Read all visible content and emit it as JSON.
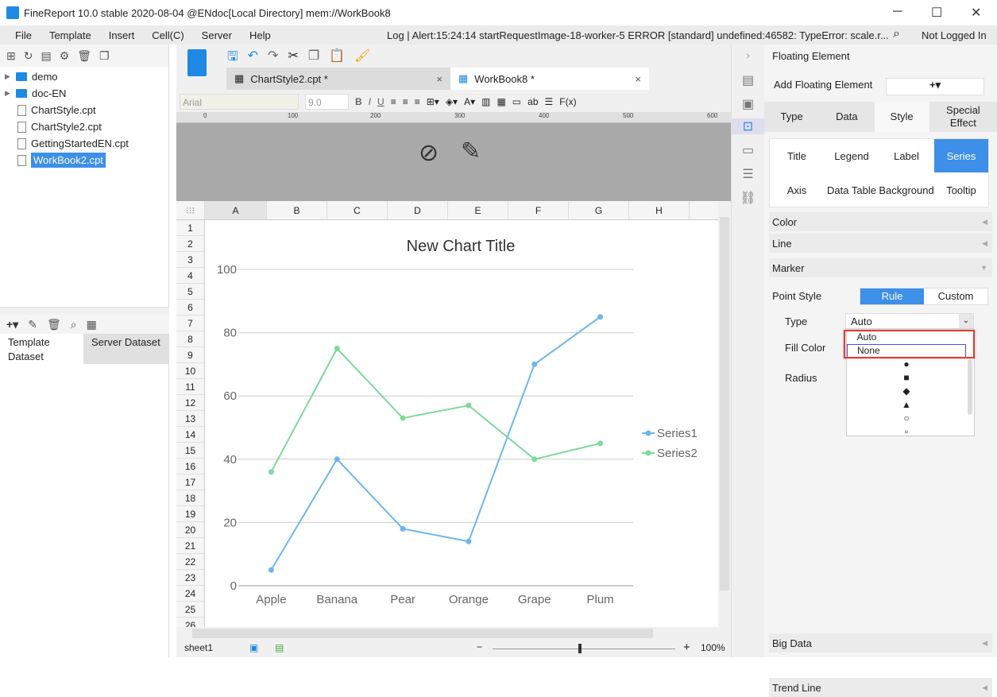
{
  "window": {
    "title": "FineReport 10.0 stable 2020-08-04 @ENdoc[Local Directory]    mem://WorkBook8",
    "minimize": "─",
    "maximize": "☐",
    "close": "✕"
  },
  "menu": {
    "items": [
      "File",
      "Template",
      "Insert",
      "Cell(C)",
      "Server",
      "Help"
    ],
    "log": "Log | Alert:15:24:14 startRequestImage-18-worker-5 ERROR [standard] undefined:46582: TypeError: scale.r...",
    "login": "Not Logged In"
  },
  "tree": {
    "folders": [
      "demo",
      "doc-EN"
    ],
    "files": [
      "ChartStyle.cpt",
      "ChartStyle2.cpt",
      "GettingStartedEN.cpt",
      "WorkBook2.cpt"
    ],
    "selected": "WorkBook2.cpt"
  },
  "dataset": {
    "tab1": "Template Dataset",
    "tab2": "Server Dataset"
  },
  "tabs": [
    {
      "label": "ChartStyle2.cpt *"
    },
    {
      "label": "WorkBook8 *"
    }
  ],
  "format": {
    "font": "Arial",
    "size": "9.0",
    "bold": "B",
    "italic": "I",
    "underline": "U",
    "ab": "ab",
    "fx": "F(x)"
  },
  "ruler": [
    "0",
    "100",
    "200",
    "300",
    "400",
    "500",
    "600"
  ],
  "columns": [
    "A",
    "B",
    "C",
    "D",
    "E",
    "F",
    "G",
    "H"
  ],
  "rows": [
    "1",
    "2",
    "3",
    "4",
    "5",
    "6",
    "7",
    "8",
    "9",
    "10",
    "11",
    "12",
    "13",
    "14",
    "15",
    "16",
    "17",
    "18",
    "19",
    "20",
    "21",
    "22",
    "23",
    "24",
    "25",
    "26"
  ],
  "chart_data": {
    "type": "line",
    "title": "New Chart Title",
    "categories": [
      "Apple",
      "Banana",
      "Pear",
      "Orange",
      "Grape",
      "Plum"
    ],
    "ylim": [
      0,
      100
    ],
    "yticks": [
      "0",
      "20",
      "40",
      "60",
      "80",
      "100"
    ],
    "grid": true,
    "legend": "right",
    "series": [
      {
        "name": "Series1",
        "color": "#6cb6f0",
        "values": [
          5,
          40,
          18,
          14,
          70,
          85
        ]
      },
      {
        "name": "Series2",
        "color": "#7ed99a",
        "values": [
          36,
          75,
          53,
          57,
          40,
          45
        ]
      }
    ]
  },
  "bottom": {
    "sheet": "sheet1",
    "zoom": "100%",
    "minus": "−",
    "plus": "+"
  },
  "panel": {
    "title": "Floating Element",
    "add_label": "Add Floating Element",
    "add_btn": "+▾",
    "tabs": [
      "Type",
      "Data",
      "Style",
      "Special Effect"
    ],
    "style_tabs": [
      "Title",
      "Legend",
      "Label",
      "Series",
      "Axis",
      "Data Table",
      "Background",
      "Tooltip"
    ],
    "sections": {
      "color": "Color",
      "line": "Line",
      "marker": "Marker",
      "big_data": "Big Data",
      "trend_line": "Trend Line"
    },
    "point_style": "Point Style",
    "rule": "Rule",
    "custom": "Custom",
    "type_label": "Type",
    "type_value": "Auto",
    "fill_color": "Fill Color",
    "radius": "Radius",
    "dropdown": [
      "Auto",
      "None",
      "●",
      "■",
      "◆",
      "▲",
      "○",
      "▫"
    ]
  }
}
